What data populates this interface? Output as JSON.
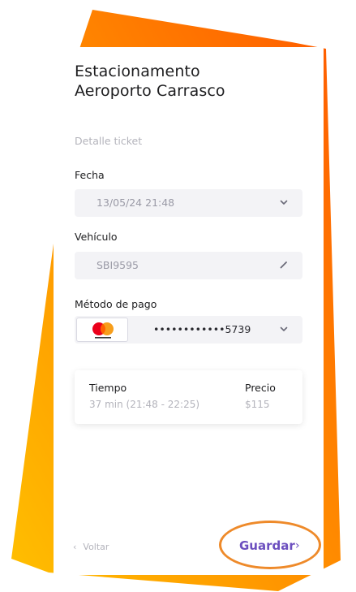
{
  "app": {
    "title": "Estacionamento Aeroporto Carrasco",
    "section_label": "Detalle ticket"
  },
  "fields": {
    "date_label": "Fecha",
    "date_value": "13/05/24 21:48",
    "vehicle_label": "Vehículo",
    "vehicle_value": "SBI9595",
    "payment_label": "Método de pago",
    "payment_value": "••••••••••••5739"
  },
  "summary": {
    "time_label": "Tiempo",
    "time_value": "37 min (21:48 - 22:25)",
    "price_label": "Precio",
    "price_value": "$115"
  },
  "footer": {
    "back_label": "Voltar",
    "save_label": "Guardar"
  },
  "icons": {
    "date_dropdown": "chevron-down-icon",
    "vehicle_edit": "pencil-icon",
    "payment_dropdown": "chevron-down-icon",
    "card_brand": "mastercard-logo"
  },
  "colors": {
    "accent": "#6c4fbf",
    "highlight_ring": "#ee8a2a",
    "background_gradient_start": "#ffc000",
    "background_gradient_end": "#ff5a00"
  }
}
